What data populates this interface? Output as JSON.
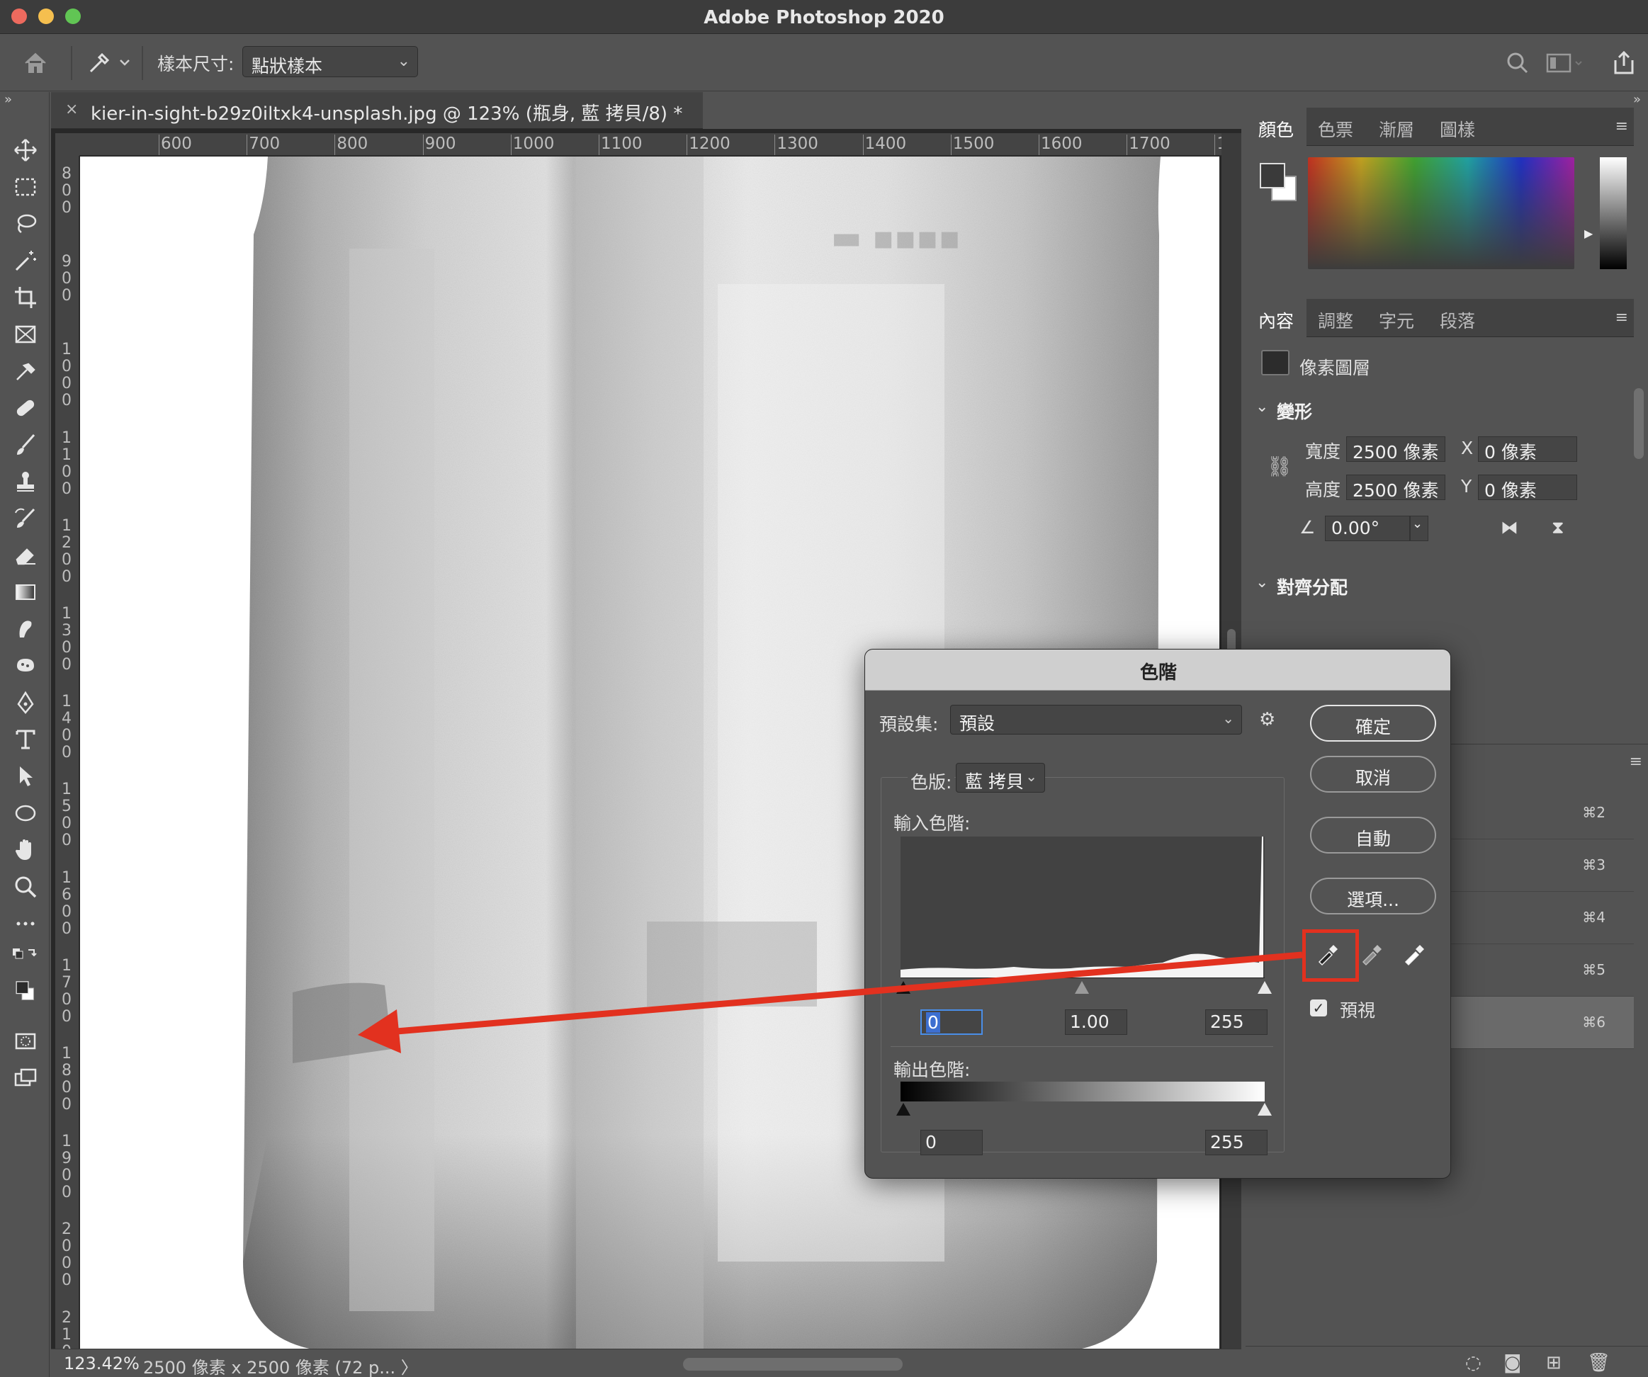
{
  "app": {
    "window_title": "Adobe Photoshop 2020"
  },
  "options_bar": {
    "sample_size_label": "樣本尺寸:",
    "sample_size_value": "點狀樣本"
  },
  "document": {
    "tab_title": "kier-in-sight-b29z0iltxk4-unsplash.jpg @ 123% (瓶身, 藍 拷貝/8) *",
    "ruler_h": [
      "600",
      "700",
      "800",
      "900",
      "1000",
      "1100",
      "1200",
      "1300",
      "1400",
      "1500",
      "1600",
      "1700",
      "1"
    ],
    "ruler_v": [
      "800",
      "900",
      "1000",
      "1100",
      "1200",
      "1300",
      "1400",
      "1500",
      "1600",
      "1700",
      "1800",
      "1900",
      "2000",
      "210"
    ]
  },
  "status_bar": {
    "zoom": "123.42%",
    "info": "2500 像素 x 2500 像素 (72 p...",
    "arrow": "〉"
  },
  "color_panel": {
    "tabs": [
      "顏色",
      "色票",
      "漸層",
      "圖樣"
    ]
  },
  "properties_panel": {
    "tabs": [
      "內容",
      "調整",
      "字元",
      "段落"
    ],
    "layer_type": "像素圖層",
    "transform_heading": "變形",
    "width_label": "寬度",
    "width_value": "2500 像素",
    "height_label": "高度",
    "height_value": "2500 像素",
    "x_label": "X",
    "x_value": "0 像素",
    "y_label": "Y",
    "y_value": "0 像素",
    "angle_value": "0.00°",
    "align_heading": "對齊分配"
  },
  "channels_panel": {
    "shortcuts": [
      "⌘2",
      "⌘3",
      "⌘4",
      "⌘5",
      "⌘6"
    ],
    "selected_index": 4
  },
  "levels_dialog": {
    "title": "色階",
    "preset_label": "預設集:",
    "preset_value": "預設",
    "channel_label": "色版:",
    "channel_value": "藍 拷貝",
    "input_levels_label": "輸入色階:",
    "input_black": "0",
    "input_gamma": "1.00",
    "input_white": "255",
    "output_levels_label": "輸出色階:",
    "output_black": "0",
    "output_white": "255",
    "ok_button": "確定",
    "cancel_button": "取消",
    "auto_button": "自動",
    "options_button": "選項...",
    "preview_label": "預視",
    "preview_checked": true
  },
  "colors": {
    "annotation_red": "#e2311f",
    "panel_bg": "#535353",
    "dark_bg": "#282828"
  }
}
